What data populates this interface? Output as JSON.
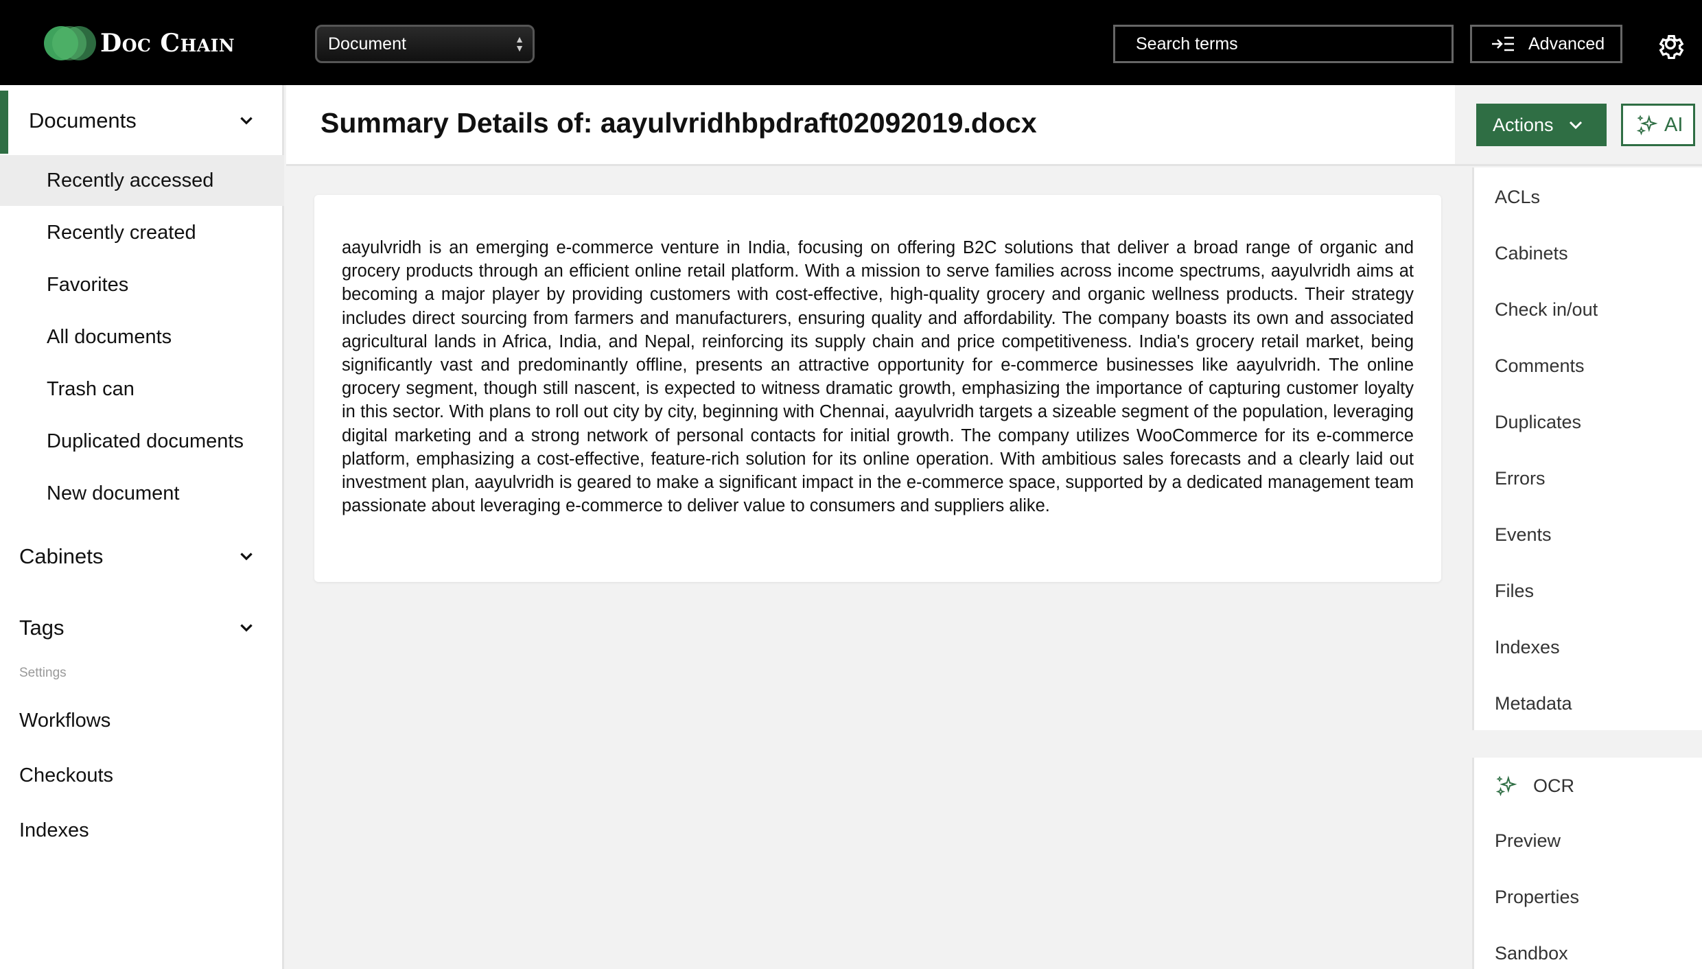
{
  "app": {
    "name": "Doc Chain"
  },
  "topbar": {
    "type_select": "Document",
    "search_placeholder": "Search terms",
    "advanced_label": "Advanced"
  },
  "sidebar": {
    "documents_label": "Documents",
    "document_items": [
      {
        "label": "Recently accessed",
        "selected": true
      },
      {
        "label": "Recently created"
      },
      {
        "label": "Favorites"
      },
      {
        "label": "All documents"
      },
      {
        "label": "Trash can"
      },
      {
        "label": "Duplicated documents"
      },
      {
        "label": "New document"
      }
    ],
    "cabinets_label": "Cabinets",
    "tags_label": "Tags",
    "settings_label": "Settings",
    "settings_links": [
      "Workflows",
      "Checkouts",
      "Indexes"
    ]
  },
  "main": {
    "title": "Summary Details of: aayulvridhbpdraft02092019.docx",
    "summary": "aayulvridh is an emerging e-commerce venture in India, focusing on offering B2C solutions that deliver a broad range of organic and grocery products through an efficient online retail platform. With a mission to serve families across income spectrums, aayulvridh aims at becoming a major player by providing customers with cost-effective, high-quality grocery and organic wellness products. Their strategy includes direct sourcing from farmers and manufacturers, ensuring quality and affordability. The company boasts its own and associated agricultural lands in Africa, India, and Nepal, reinforcing its supply chain and price competitiveness. India's grocery retail market, being significantly vast and predominantly offline, presents an attractive opportunity for e-commerce businesses like aayulvridh. The online grocery segment, though still nascent, is expected to witness dramatic growth, emphasizing the importance of capturing customer loyalty in this sector. With plans to roll out city by city, beginning with Chennai, aayulvridh targets a sizeable segment of the population, leveraging digital marketing and a strong network of personal contacts for initial growth. The company utilizes WooCommerce for its e-commerce platform, emphasizing a cost-effective, feature-rich solution for its online operation. With ambitious sales forecasts and a clearly laid out investment plan, aayulvridh is geared to make a significant impact in the e-commerce space, supported by a dedicated management team passionate about leveraging e-commerce to deliver value to consumers and suppliers alike."
  },
  "right_panel": {
    "actions_label": "Actions",
    "ai_label": "AI",
    "items": [
      "ACLs",
      "Cabinets",
      "Check in/out",
      "Comments",
      "Duplicates",
      "Errors",
      "Events",
      "Files",
      "Indexes",
      "Metadata"
    ],
    "ocr_label": "OCR",
    "items2": [
      "Preview",
      "Properties",
      "Sandbox"
    ]
  },
  "colors": {
    "brand_green": "#2f6e44",
    "topbar": "#000000"
  }
}
